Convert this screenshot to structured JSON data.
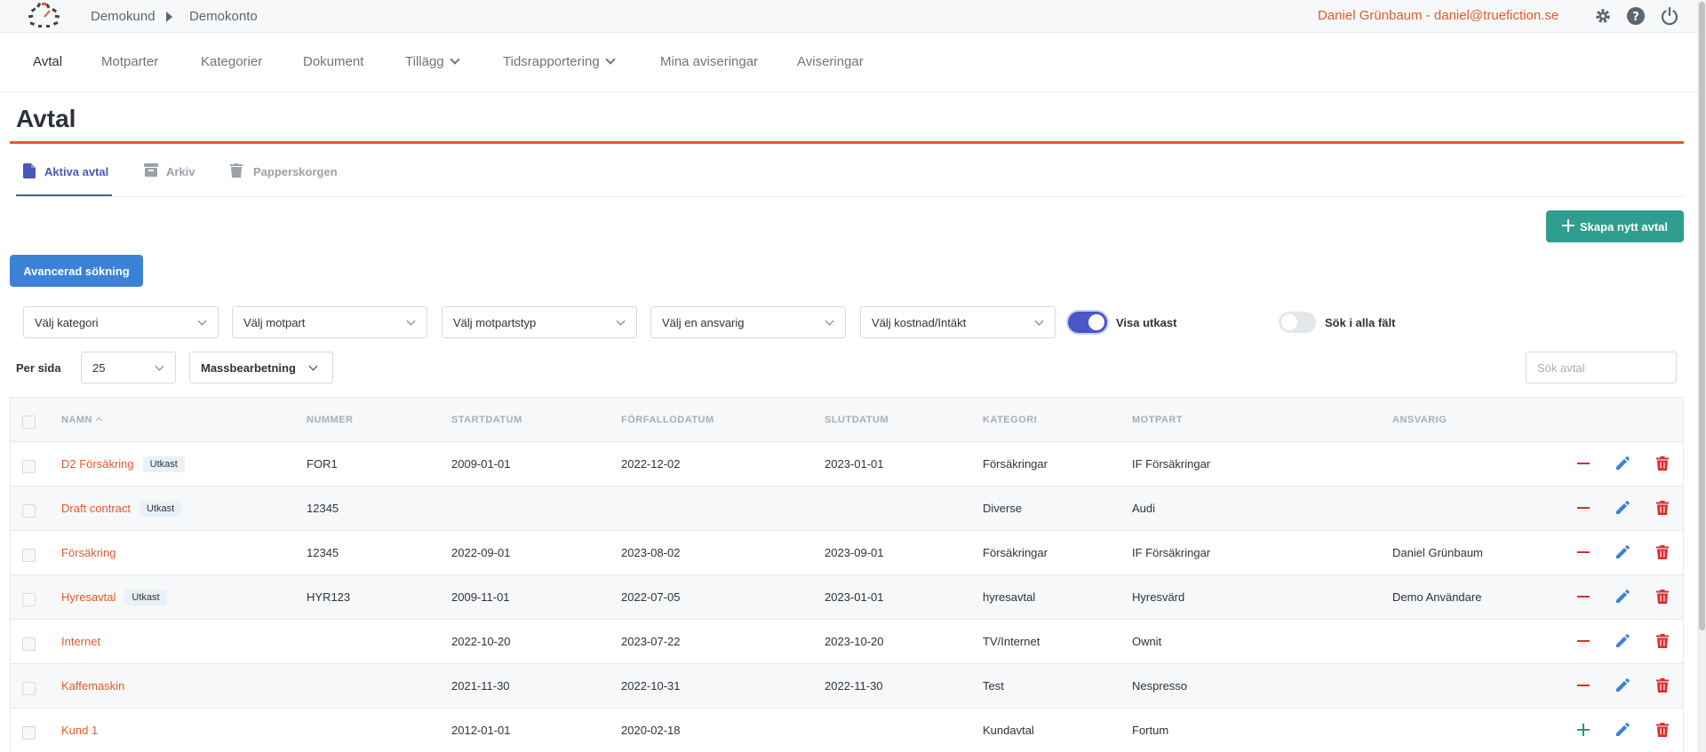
{
  "topbar": {
    "breadcrumb": [
      "Demokund",
      "Demokonto"
    ],
    "user": "Daniel Grünbaum - daniel@truefiction.se",
    "icons": [
      "gear-icon",
      "help-icon",
      "power-icon"
    ]
  },
  "nav": {
    "items": [
      {
        "label": "Avtal",
        "active": true
      },
      {
        "label": "Motparter"
      },
      {
        "label": "Kategorier"
      },
      {
        "label": "Dokument"
      },
      {
        "label": "Tillägg",
        "dropdown": true
      },
      {
        "label": "Tidsrapportering",
        "dropdown": true
      },
      {
        "label": "Mina aviseringar"
      },
      {
        "label": "Aviseringar"
      }
    ]
  },
  "page": {
    "title": "Avtal"
  },
  "tabs": [
    {
      "label": "Aktiva avtal",
      "icon": "document-icon",
      "active": true
    },
    {
      "label": "Arkiv",
      "icon": "archive-icon"
    },
    {
      "label": "Papperskorgen",
      "icon": "trash-icon"
    }
  ],
  "buttons": {
    "create": "Skapa nytt avtal",
    "advanced": "Avancerad sökning"
  },
  "filters": {
    "category": "Välj kategori",
    "counterparty": "Välj motpart",
    "counterparty_type": "Välj motpartstyp",
    "responsible": "Välj en ansvarig",
    "cost_income": "Välj kostnad/Intäkt",
    "show_drafts": {
      "label": "Visa utkast",
      "on": true
    },
    "search_all": {
      "label": "Sök i alla fält",
      "on": false
    }
  },
  "controls": {
    "per_page_label": "Per sida",
    "per_page_value": "25",
    "bulk": "Massbearbetning",
    "search_placeholder": "Sök avtal"
  },
  "table": {
    "headers": [
      "NAMN",
      "NUMMER",
      "STARTDATUM",
      "FÖRFALLODATUM",
      "SLUTDATUM",
      "KATEGORI",
      "MOTPART",
      "ANSVARIG"
    ],
    "rows": [
      {
        "name": "D2 Försäkring",
        "badge": "Utkast",
        "number": "FOR1",
        "start": "2009-01-01",
        "due": "2022-12-02",
        "end": "2023-01-01",
        "category": "Försäkringar",
        "party": "IF Försäkringar",
        "responsible": "",
        "toggle": "minus"
      },
      {
        "name": "Draft contract",
        "badge": "Utkast",
        "number": "12345",
        "start": "",
        "due": "",
        "end": "",
        "category": "Diverse",
        "party": "Audi",
        "responsible": "",
        "toggle": "minus"
      },
      {
        "name": "Försäkring",
        "badge": "",
        "number": "12345",
        "start": "2022-09-01",
        "due": "2023-08-02",
        "end": "2023-09-01",
        "category": "Försäkringar",
        "party": "IF Försäkringar",
        "responsible": "Daniel Grünbaum",
        "toggle": "minus"
      },
      {
        "name": "Hyresavtal",
        "badge": "Utkast",
        "number": "HYR123",
        "start": "2009-11-01",
        "due": "2022-07-05",
        "end": "2023-01-01",
        "category": "hyresavtal",
        "party": "Hyresvärd",
        "responsible": "Demo Användare",
        "toggle": "minus"
      },
      {
        "name": "Internet",
        "badge": "",
        "number": "",
        "start": "2022-10-20",
        "due": "2023-07-22",
        "end": "2023-10-20",
        "category": "TV/Internet",
        "party": "Ownit",
        "responsible": "",
        "toggle": "minus"
      },
      {
        "name": "Kaffemaskin",
        "badge": "",
        "number": "",
        "start": "2021-11-30",
        "due": "2022-10-31",
        "end": "2022-11-30",
        "category": "Test",
        "party": "Nespresso",
        "responsible": "",
        "toggle": "minus"
      },
      {
        "name": "Kund 1",
        "badge": "",
        "number": "",
        "start": "2012-01-01",
        "due": "2020-02-18",
        "end": "",
        "category": "Kundavtal",
        "party": "Fortum",
        "responsible": "",
        "toggle": "plus"
      }
    ]
  },
  "colors": {
    "accent": "#e35a2b",
    "primary": "#3b82d6",
    "create": "#2f9e8f",
    "tab_active": "#4a57b8",
    "danger": "#d92e2e",
    "add": "#2a9d5c"
  }
}
